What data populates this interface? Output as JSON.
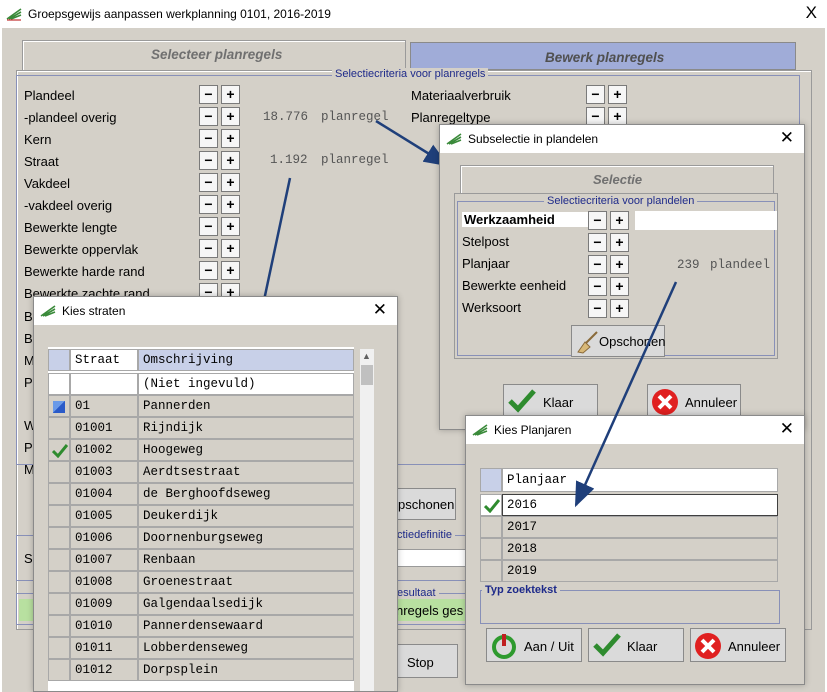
{
  "main": {
    "title": "Groepsgewijs aanpassen werkplanning 0101, 2016-2019",
    "close": "X",
    "tab_active": "Selecteer planregels",
    "tab_inactive": "Bewerk planregels",
    "criteria_caption": "Selectiecriteria voor planregels",
    "rows": [
      "Plandeel",
      "-plandeel overig",
      "Kern",
      "Straat",
      "Vakdeel",
      "-vakdeel overig",
      "Bewerkte lengte",
      "Bewerkte oppervlak",
      "Bewerkte harde rand",
      "Bewerkte zachte rand"
    ],
    "partial_letters": [
      "B",
      "B",
      "M",
      "P",
      "W",
      "P",
      "M"
    ],
    "count_plandeel_num": "18.776",
    "count_plandeel_unit": "planregel",
    "count_straat_num": "1.192",
    "count_straat_unit": "planregel",
    "right_rows": [
      "Materiaalverbruik",
      "Planregeltype"
    ],
    "opschonen_partial": "pschonen",
    "selectiedefinitie_partial": "ctiedefinitie",
    "resultaat_partial": "esultaat",
    "result_text_partial": "nregels ges",
    "stop": "Stop",
    "s_partial": "S"
  },
  "sub": {
    "title": "Subselectie in plandelen",
    "tab": "Selectie",
    "caption": "Selectiecriteria voor plandelen",
    "rows": [
      "Werkzaamheid",
      "Stelpost",
      "Planjaar",
      "Bewerkte eenheid",
      "Werksoort"
    ],
    "count_num": "239",
    "count_unit": "plandeel",
    "opschonen": "Opschonen",
    "klaar": "Klaar",
    "annuleer": "Annuleer"
  },
  "straten": {
    "title": "Kies straten",
    "col1": "Straat",
    "col2": "Omschrijving",
    "rows": [
      {
        "code": "",
        "name": "(Niet ingevuld)"
      },
      {
        "code": "01",
        "name": "Pannerden"
      },
      {
        "code": "01001",
        "name": "Rijndijk"
      },
      {
        "code": "01002",
        "name": "Hoogeweg"
      },
      {
        "code": "01003",
        "name": "Aerdtsestraat"
      },
      {
        "code": "01004",
        "name": "de Berghoofdseweg"
      },
      {
        "code": "01005",
        "name": "Deukerdijk"
      },
      {
        "code": "01006",
        "name": "Doornenburgseweg"
      },
      {
        "code": "01007",
        "name": "Renbaan"
      },
      {
        "code": "01008",
        "name": "Groenestraat"
      },
      {
        "code": "01009",
        "name": "Galgendaalsedijk"
      },
      {
        "code": "01010",
        "name": "Pannerdensewaard"
      },
      {
        "code": "01011",
        "name": "Lobberdenseweg"
      },
      {
        "code": "01012",
        "name": "Dorpsplein"
      }
    ]
  },
  "planjaren": {
    "title": "Kies Planjaren",
    "col": "Planjaar",
    "rows": [
      "2016",
      "2017",
      "2018",
      "2019"
    ],
    "search_caption": "Typ zoektekst",
    "aan_uit": "Aan / Uit",
    "klaar": "Klaar",
    "annuleer": "Annuleer"
  },
  "colors": {
    "panel": "#d4d0c8",
    "header": "#c8d0e8",
    "arrow": "#1f3f7a",
    "check": "#2e8b2e",
    "cancel": "#e02020",
    "result": "#b8e0a0"
  }
}
